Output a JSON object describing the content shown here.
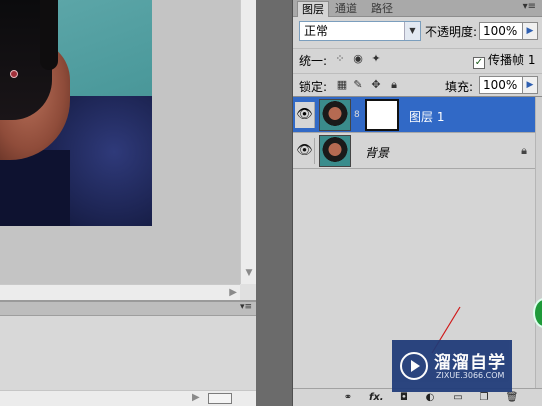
{
  "layers_panel": {
    "tabs": [
      {
        "label": "图层",
        "active": true
      },
      {
        "label": "通道",
        "active": false
      },
      {
        "label": "路径",
        "active": false
      }
    ],
    "blend_mode": "正常",
    "opacity_label": "不透明度:",
    "opacity_value": "100%",
    "unify_label": "统一:",
    "propagate_label": "传播帧 1",
    "propagate_checked": true,
    "lock_label": "锁定:",
    "fill_label": "填充:",
    "fill_value": "100%",
    "layers": [
      {
        "name": "图层 1",
        "visible": true,
        "selected": true,
        "has_mask": true
      },
      {
        "name": "背景",
        "visible": true,
        "selected": false,
        "locked": true
      }
    ],
    "selected_color": "#3169c6"
  },
  "icons": {
    "tab_menu": "panel-menu-icon",
    "eye": "eye-icon",
    "lock": "lock-icon",
    "link": "chain-link-icon",
    "footer": [
      "link-layers-icon",
      "fx-icon",
      "mask-icon",
      "adjustment-icon",
      "group-icon",
      "new-layer-icon",
      "trash-icon"
    ]
  },
  "watermark": {
    "title": "溜溜自学",
    "url": "ZIXUE.3066.COM"
  }
}
